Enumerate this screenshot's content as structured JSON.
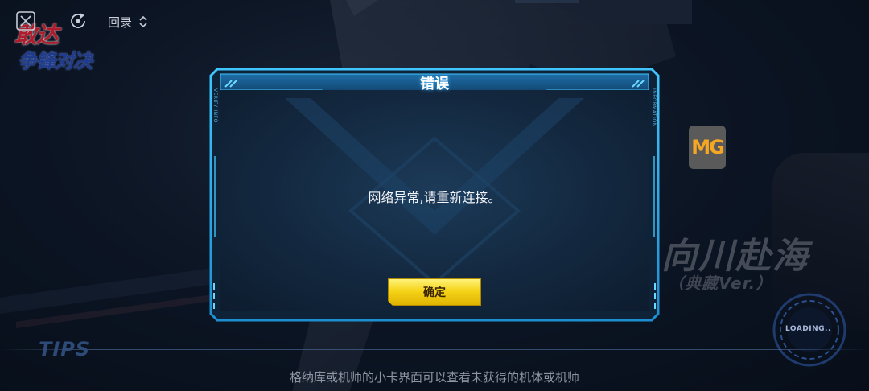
{
  "topbar": {
    "record_label": "回录"
  },
  "logo": {
    "line1": "敢达",
    "line2": "争锋对决"
  },
  "badge": {
    "m": "M",
    "g": "G"
  },
  "background": {
    "title": "向川赴海",
    "subtitle": "（典藏Ver.）"
  },
  "loading": {
    "label": "LOADING.."
  },
  "dialog": {
    "title": "错误",
    "message": "网络异常,请重新连接。",
    "confirm_label": "确定",
    "side_left": "VERIFY INFO",
    "side_right": "INFORMATION"
  },
  "tips": {
    "label": "TIPS",
    "text": "格纳库或机师的小卡界面可以查看未获得的机体或机师"
  },
  "colors": {
    "frame_accent": "#2fb3ee",
    "button_yellow": "#f5d419",
    "badge_orange": "#f5a623"
  }
}
